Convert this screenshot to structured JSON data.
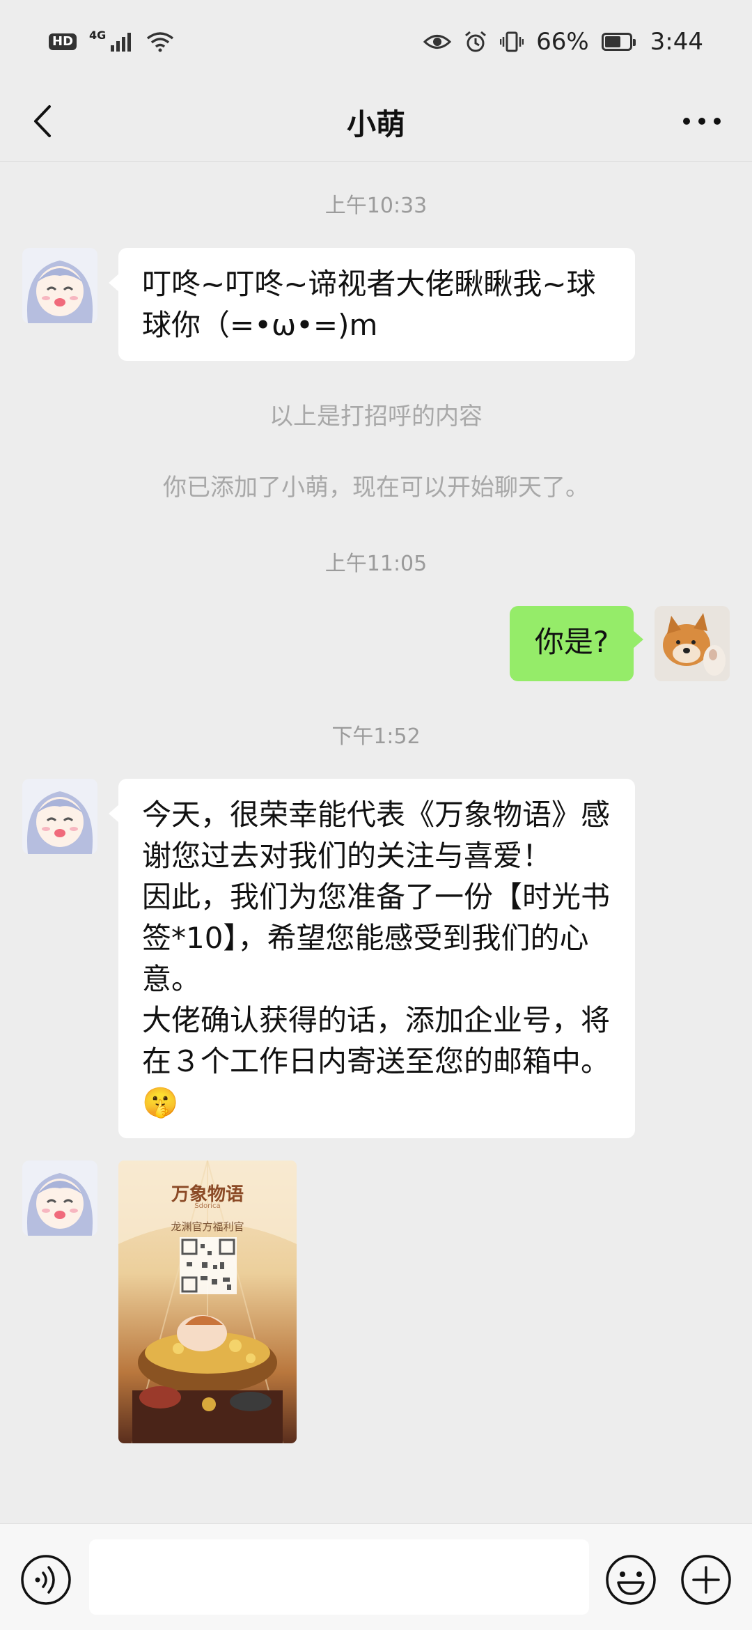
{
  "status_bar": {
    "hd_label": "HD",
    "network_label": "4G",
    "battery_percent": "66%",
    "battery_level": 0.66,
    "time": "3:44"
  },
  "header": {
    "title": "小萌",
    "back_icon": "chevron-left-icon",
    "more_icon": "more-dots-icon"
  },
  "messages": {
    "ts1": "上午10:33",
    "greeting": "叮咚~叮咚~谛视者大佬瞅瞅我~球球你（=•ω•=)m",
    "system1": "以上是打招呼的内容",
    "system2": "你已添加了小萌，现在可以开始聊天了。",
    "ts2": "上午11:05",
    "my_reply": "你是?",
    "ts3": "下午1:52",
    "long_msg": "今天，很荣幸能代表《万象物语》感谢您过去对我们的关注与喜爱！\n因此，我们为您准备了一份【时光书签*10】，希望您能感受到我们的心意。\n大佬确认获得的话，添加企业号，将在３个工作日内寄送至您的邮箱中。🤫",
    "image_brand": "万象物语",
    "image_brand_sub": "Sdorica",
    "image_caption": "龙渊官方福利官"
  },
  "input_bar": {
    "placeholder": "",
    "voice_icon": "voice-icon",
    "emoji_icon": "emoji-icon",
    "plus_icon": "plus-icon"
  },
  "colors": {
    "background": "#ededed",
    "my_bubble": "#95ec69",
    "other_bubble": "#ffffff"
  }
}
